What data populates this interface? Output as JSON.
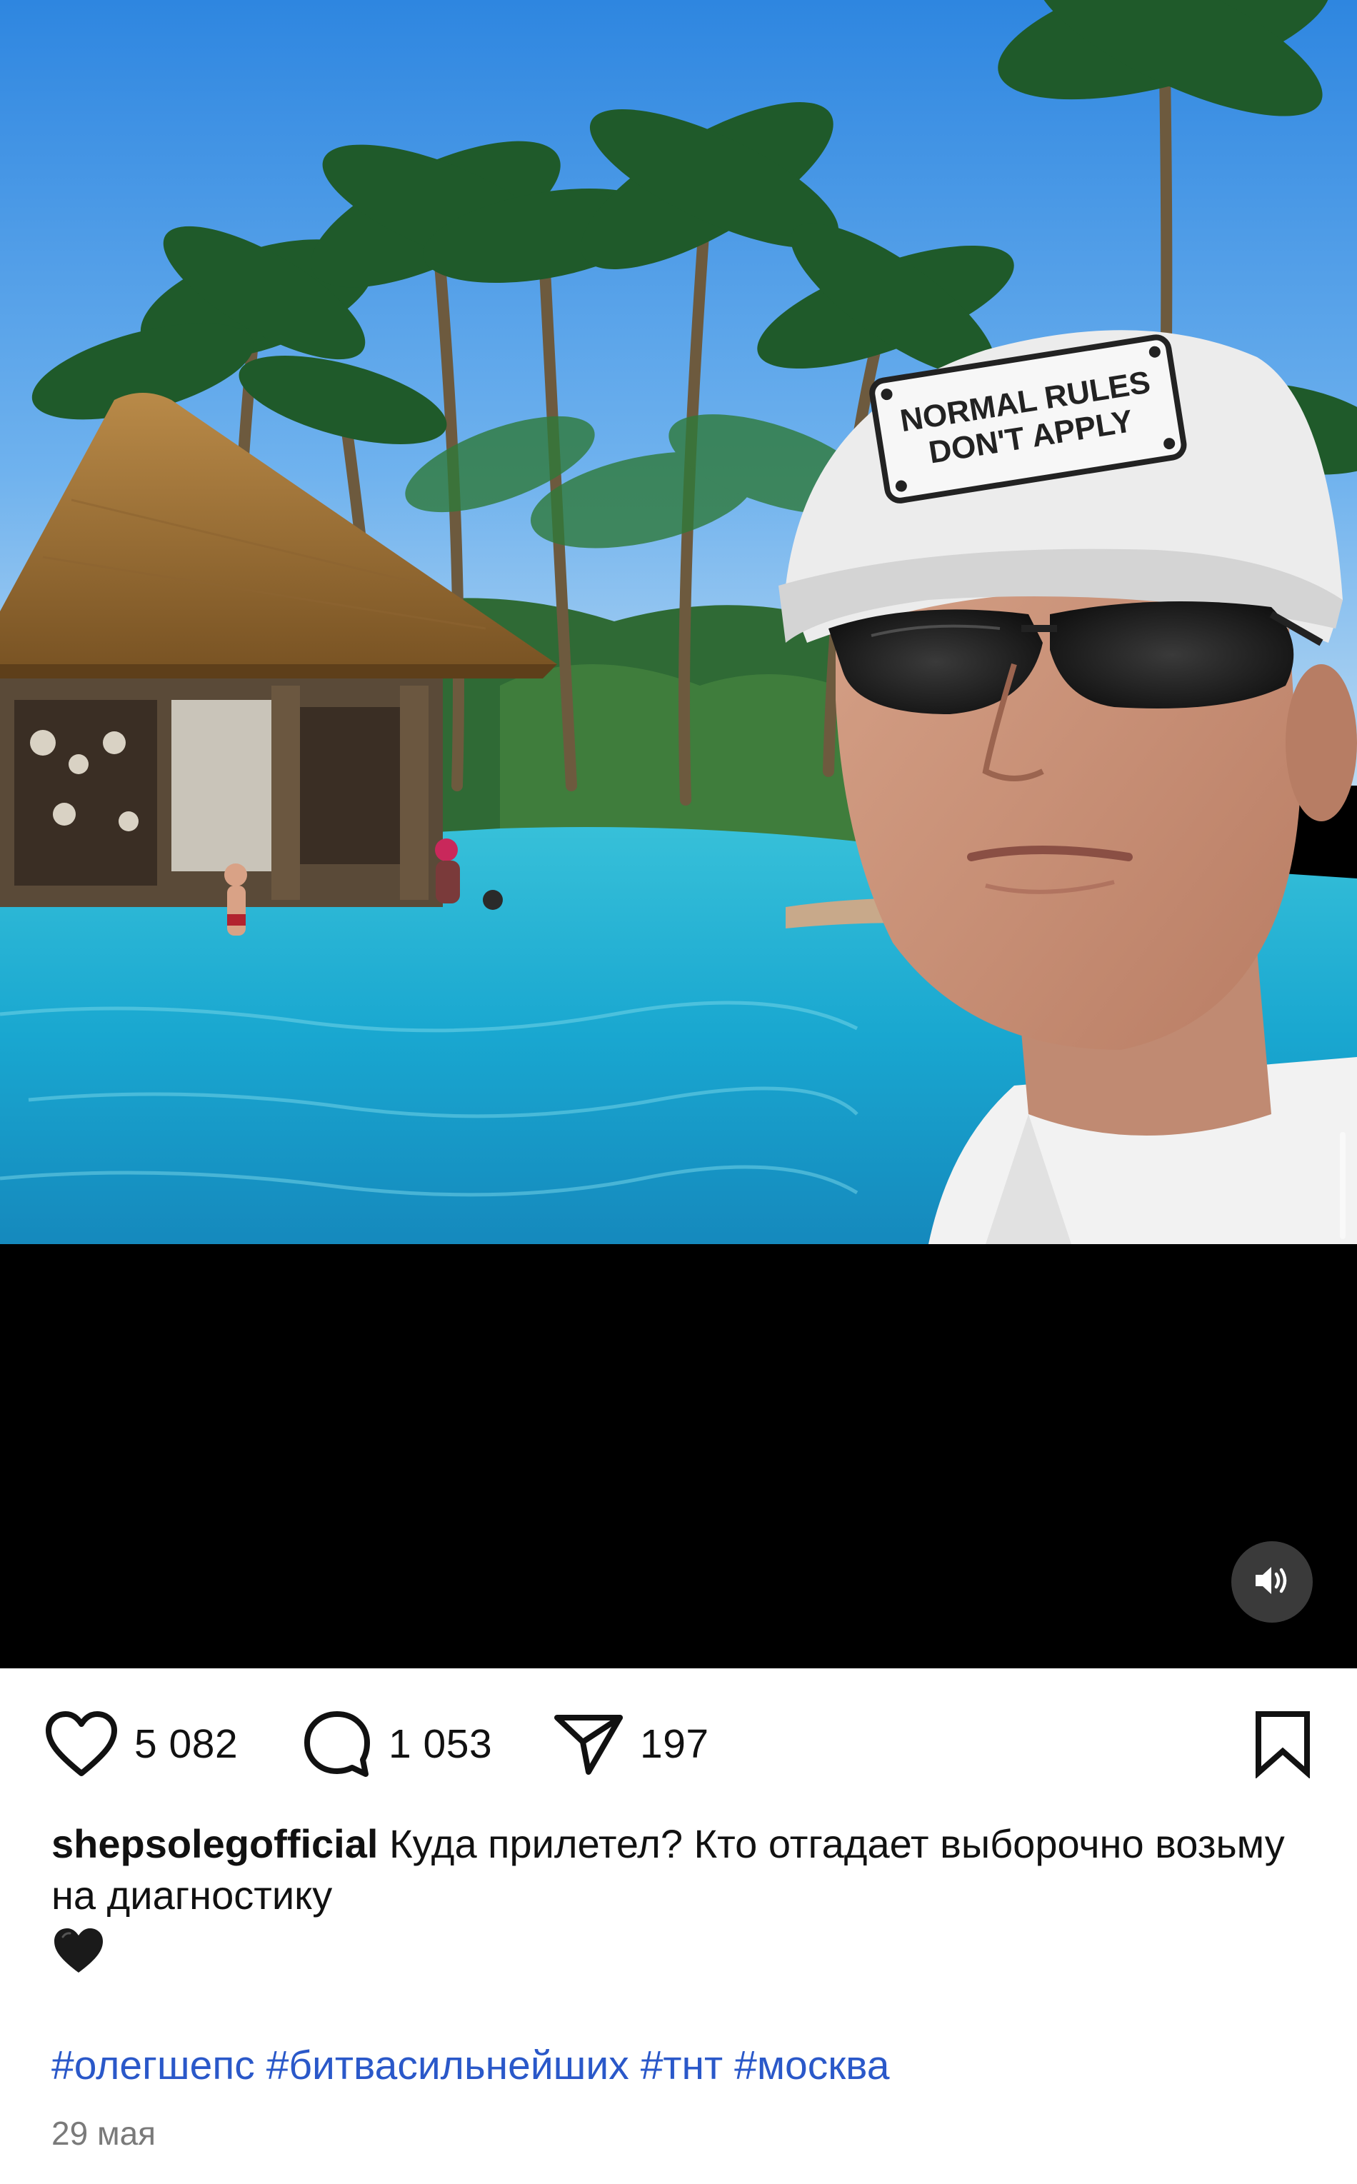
{
  "post": {
    "media": {
      "cap_text_line1": "NORMAL RULES",
      "cap_text_line2": "DON'T APPLY",
      "sound_icon": "speaker-icon"
    },
    "actions": {
      "like_icon": "heart-outline-icon",
      "likes": "5 082",
      "comment_icon": "comment-bubble-icon",
      "comments": "1 053",
      "share_icon": "paper-plane-icon",
      "shares": "197",
      "save_icon": "bookmark-outline-icon"
    },
    "caption": {
      "username": "shepsolegofficial",
      "text": "Куда прилетел? Кто отгадает выборочно возьму на диагностику",
      "emoji_icon": "black-heart-icon"
    },
    "hashtags": [
      "#олегшепс",
      "#битвасильнейших",
      "#тнт",
      "#москва"
    ],
    "date": "29 мая"
  },
  "colors": {
    "hashtag": "#2a58c9",
    "text": "#111111",
    "muted": "#7a7a7a",
    "video_letterbox": "#000000"
  }
}
